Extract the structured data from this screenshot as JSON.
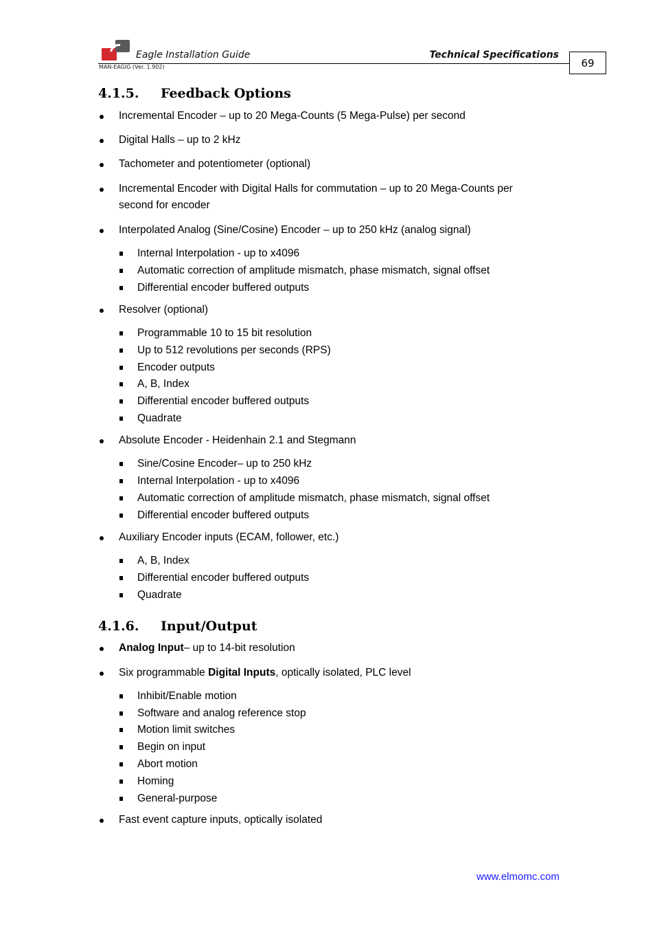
{
  "header": {
    "document_title": "Eagle Installation Guide",
    "document_version": "MAN-EAGIG (Ver. 1.902)",
    "section_title": "Technical Specifications",
    "page_number": "69"
  },
  "sections": [
    {
      "number": "4.1.5.",
      "title": "Feedback Options",
      "items": [
        {
          "text": "Incremental Encoder – up to 20 Mega-Counts (5 Mega-Pulse) per second"
        },
        {
          "text": "Digital Halls – up to 2 kHz"
        },
        {
          "text": "Tachometer and potentiometer (optional)"
        },
        {
          "text_line1": "Incremental Encoder with Digital Halls for commutation – up to 20 Mega-Counts per",
          "text_line2": "second for encoder"
        },
        {
          "text": "Interpolated Analog (Sine/Cosine) Encoder – up to 250 kHz (analog signal)",
          "subitems": [
            "Internal Interpolation - up to x4096",
            "Automatic correction of amplitude mismatch, phase mismatch, signal offset",
            "Differential encoder buffered outputs"
          ]
        },
        {
          "text": "Resolver (optional)",
          "subitems": [
            "Programmable 10 to 15 bit resolution",
            "Up to 512 revolutions per seconds (RPS)",
            "Encoder outputs",
            "A, B, Index",
            "Differential encoder buffered outputs",
            "Quadrate"
          ]
        },
        {
          "text": "Absolute Encoder - Heidenhain 2.1 and Stegmann",
          "subitems": [
            "Sine/Cosine Encoder– up to 250 kHz",
            "Internal Interpolation - up to x4096",
            "Automatic correction of amplitude mismatch, phase mismatch, signal offset",
            "Differential encoder buffered outputs"
          ]
        },
        {
          "text": "Auxiliary Encoder inputs (ECAM, follower, etc.)",
          "subitems": [
            "A, B, Index",
            "Differential encoder buffered outputs",
            "Quadrate"
          ]
        }
      ]
    },
    {
      "number": "4.1.6.",
      "title": "Input/Output",
      "items": [
        {
          "bold": "Analog Input",
          "text": "– up to 14-bit resolution"
        },
        {
          "prefix": "Six programmable ",
          "bold": "Digital Inputs",
          "text": ", optically isolated, PLC level",
          "subitems": [
            "Inhibit/Enable motion",
            "Software and analog reference stop",
            "Motion limit switches",
            "Begin on input",
            "Abort motion",
            "Homing",
            "General-purpose"
          ]
        },
        {
          "text": "Fast event capture inputs, optically isolated"
        }
      ]
    }
  ],
  "footer": {
    "website": "www.elmomc.com"
  },
  "colors": {
    "logo_red": "#d42a2f",
    "logo_gray": "#58595b",
    "link": "#1a1aff"
  }
}
